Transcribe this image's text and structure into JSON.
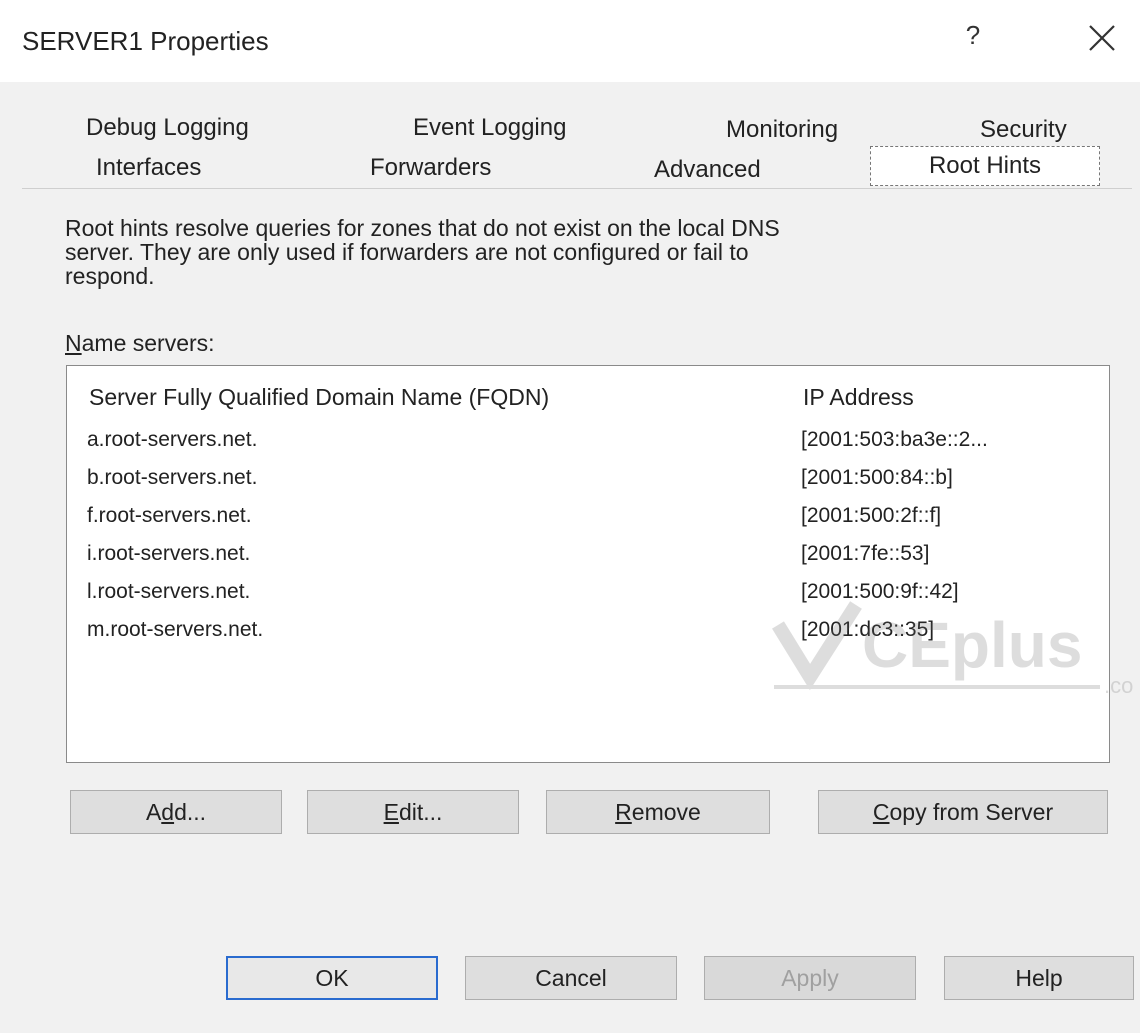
{
  "window": {
    "title": "SERVER1 Properties",
    "help_glyph": "?"
  },
  "tabs": {
    "row1": [
      "Debug Logging",
      "Event Logging",
      "Monitoring",
      "Security"
    ],
    "row2": [
      "Interfaces",
      "Forwarders",
      "Advanced",
      "Root Hints"
    ],
    "selected": "Root Hints"
  },
  "content": {
    "description_line1": "Root hints resolve queries for zones that do not exist on the local DNS",
    "description_line2": "server.  They are only used if forwarders are not configured or fail to",
    "description_line3": "respond.",
    "name_servers_label_first": "N",
    "name_servers_label_rest": "ame servers:"
  },
  "table": {
    "columns": [
      "Server Fully Qualified Domain Name (FQDN)",
      "IP Address"
    ],
    "rows": [
      {
        "fqdn": "a.root-servers.net.",
        "ip": "[2001:503:ba3e::2..."
      },
      {
        "fqdn": "b.root-servers.net.",
        "ip": "[2001:500:84::b]"
      },
      {
        "fqdn": "f.root-servers.net.",
        "ip": "[2001:500:2f::f]"
      },
      {
        "fqdn": "i.root-servers.net.",
        "ip": "[2001:7fe::53]"
      },
      {
        "fqdn": "l.root-servers.net.",
        "ip": "[2001:500:9f::42]"
      },
      {
        "fqdn": "m.root-servers.net.",
        "ip": "[2001:dc3::35]"
      }
    ]
  },
  "buttons": {
    "add_pre": "A",
    "add_acc": "d",
    "add_post": "d...",
    "edit_acc": "E",
    "edit_post": "dit...",
    "remove_acc": "R",
    "remove_post": "emove",
    "copy_acc": "C",
    "copy_post": "opy from Server",
    "ok": "OK",
    "cancel": "Cancel",
    "apply": "Apply",
    "help": "Help"
  },
  "watermark": {
    "text": "CEplus",
    "suffix": ".co"
  }
}
